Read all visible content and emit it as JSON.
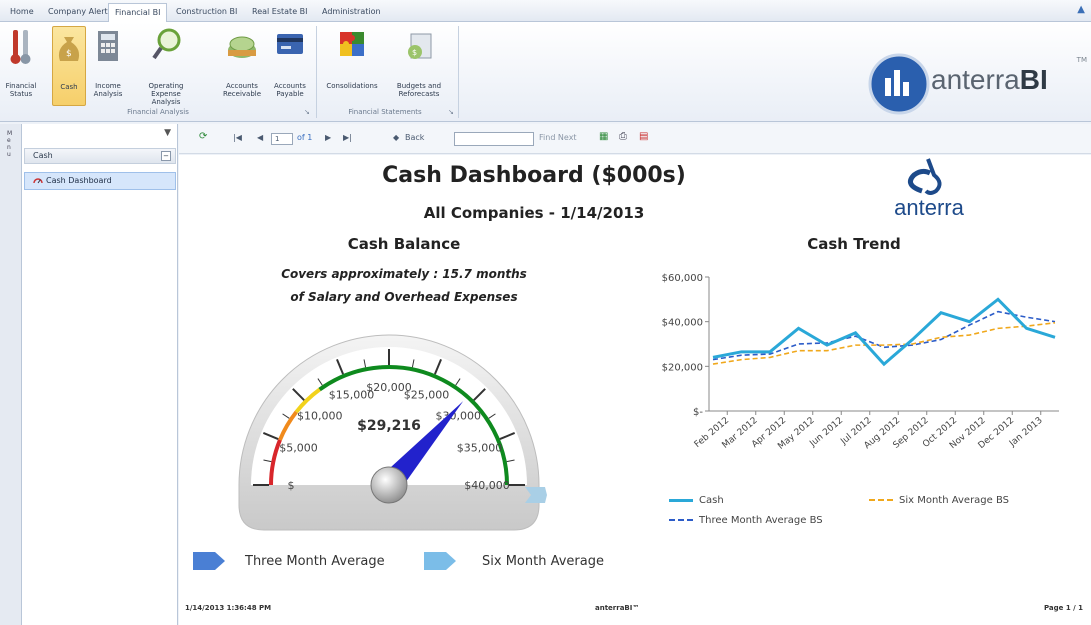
{
  "tabs": [
    "Home",
    "Company Alerts",
    "Financial BI",
    "Construction BI",
    "Real Estate BI",
    "Administration"
  ],
  "ribbon": {
    "groups": {
      "analysis": "Financial Analysis",
      "statements": "Financial Statements"
    },
    "buttons": {
      "financial_status": "Financial Status",
      "cash": "Cash",
      "income_analysis": "Income Analysis",
      "operating_expense": "Operating Expense Analysis",
      "accounts_receivable": "Accounts Receivable",
      "accounts_payable": "Accounts Payable",
      "consolidations": "Consolidations",
      "budgets": "Budgets and Reforecasts"
    }
  },
  "brand": {
    "name_light": "anterra",
    "name_bold": "BI",
    "tm": "TM"
  },
  "side_strip": "M e n u",
  "nav": {
    "header": "Cash",
    "collapse": "−",
    "item": "Cash Dashboard"
  },
  "toolbar": {
    "page": "1",
    "of": "of 1",
    "back": "Back",
    "find_next": "Find Next"
  },
  "report": {
    "title": "Cash Dashboard ($000s)",
    "subtitle": "All Companies  -  1/14/2013",
    "cash_balance_title": "Cash Balance",
    "covers_line1": "Covers approximately : 15.7 months",
    "covers_line2": "of Salary and Overhead Expenses",
    "cash_trend_title": "Cash Trend",
    "logo_word": "anterra",
    "gauge": {
      "value_label": "$29,216",
      "value": 29216,
      "min": 0,
      "max": 40000,
      "tick_labels": [
        "$",
        "$5,000",
        "$10,000",
        "$15,000",
        "$20,000",
        "$25,000",
        "$30,000",
        "$35,000",
        "$40,000"
      ],
      "legend_three": "Three Month Average",
      "legend_six": "Six Month Average",
      "colors": {
        "needle": "#2222cc",
        "three_marker": "#4a7fd4",
        "six_marker": "#7bbde8"
      }
    },
    "footer": {
      "left": "1/14/2013 1:36:48 PM",
      "center": "anterraBI™",
      "right": "Page 1 / 1"
    }
  },
  "chart_data": {
    "type": "line",
    "title": "Cash Trend",
    "categories": [
      "Feb 2012",
      "Mar 2012",
      "Apr 2012",
      "May 2012",
      "Jun 2012",
      "Jul 2012",
      "Aug 2012",
      "Sep 2012",
      "Oct 2012",
      "Nov 2012",
      "Dec 2012",
      "Jan 2013"
    ],
    "y_ticks": [
      "$60,000",
      "$40,000",
      "$20,000",
      "$-"
    ],
    "ylim": [
      0,
      60000
    ],
    "series": [
      {
        "name": "Cash",
        "color": "#2aa8d8",
        "style": "solid",
        "values": [
          24000,
          26500,
          26500,
          37000,
          29500,
          35000,
          21000,
          32000,
          44000,
          40000,
          50000,
          37000,
          33000
        ]
      },
      {
        "name": "Six Month Average BS",
        "color": "#f0a81c",
        "style": "dashed",
        "values": [
          21000,
          23000,
          24000,
          27000,
          27000,
          29500,
          29500,
          30000,
          33000,
          34000,
          37000,
          38000,
          39500
        ]
      },
      {
        "name": "Three Month Average BS",
        "color": "#2c5cc8",
        "style": "dashed",
        "values": [
          23000,
          25000,
          25500,
          30000,
          30500,
          33500,
          28500,
          29500,
          32000,
          38500,
          44500,
          42000,
          40000
        ]
      }
    ],
    "legend_position": "bottom",
    "grid": false
  }
}
